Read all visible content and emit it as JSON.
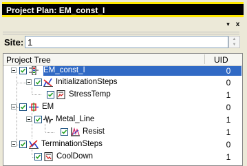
{
  "window": {
    "title": "Project Plan: EM_const_I",
    "controls": {
      "dropdown": "▾",
      "close": "x"
    }
  },
  "site": {
    "label": "Site:",
    "value": "1"
  },
  "tree": {
    "columns": {
      "name": "Project Tree",
      "uid": "UID"
    },
    "rows": [
      {
        "label": "EM_const_I",
        "uid": "0",
        "icon": "project-icon",
        "selected": true
      },
      {
        "label": "InitializationSteps",
        "uid": "0",
        "icon": "init-steps-icon",
        "selected": false
      },
      {
        "label": "StressTemp",
        "uid": "1",
        "icon": "document-icon",
        "selected": false
      },
      {
        "label": "EM",
        "uid": "0",
        "icon": "em-icon",
        "selected": false
      },
      {
        "label": "Metal_Line",
        "uid": "1",
        "icon": "resistor-icon",
        "selected": false
      },
      {
        "label": "Resist",
        "uid": "1",
        "icon": "resist-icon",
        "selected": false
      },
      {
        "label": "TerminationSteps",
        "uid": "0",
        "icon": "term-steps-icon",
        "selected": false
      },
      {
        "label": "CoolDown",
        "uid": "1",
        "icon": "document-icon",
        "selected": false
      }
    ]
  },
  "colors": {
    "title_bg": "#000000",
    "title_border": "#ffe800",
    "selection": "#316ac5"
  }
}
